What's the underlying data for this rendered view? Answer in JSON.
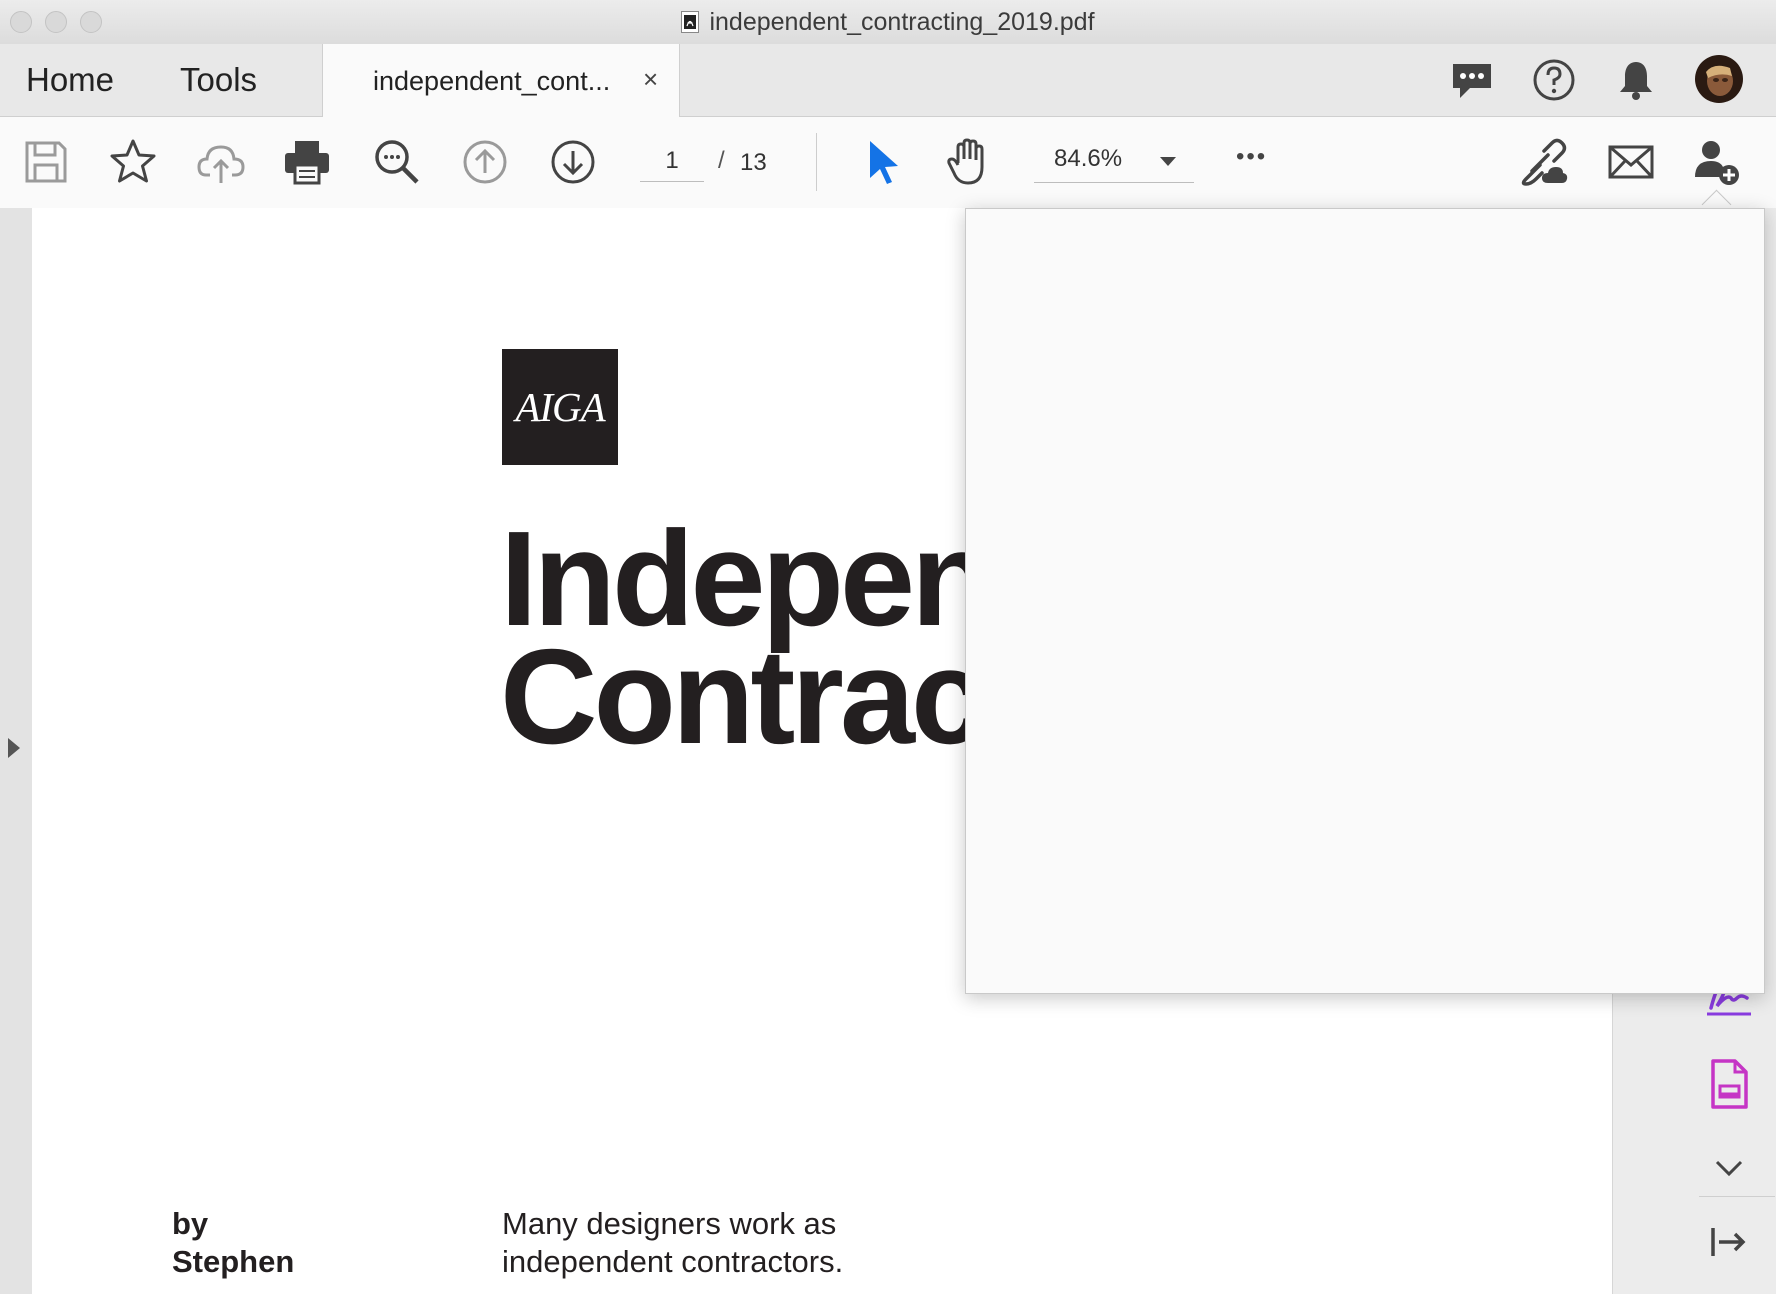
{
  "window": {
    "title": "independent_contracting_2019.pdf"
  },
  "tabs": {
    "home_label": "Home",
    "tools_label": "Tools",
    "document_tab_label": "independent_cont...",
    "close_symbol": "×"
  },
  "toolbar": {
    "page_current": "1",
    "page_separator": "/",
    "page_total": "13",
    "zoom": "84.6%",
    "more_symbol": "•••"
  },
  "document": {
    "logo_text": "AIGA",
    "heading_line1": "Indepen",
    "heading_line2": "Contrac",
    "byline_line1": "by",
    "byline_line2": "Stephen",
    "intro_line1": "Many designers work as",
    "intro_line2": "independent contractors."
  },
  "colors": {
    "select_tool_accent": "#1473e6",
    "fill_sign_accent": "#8a3ce0",
    "forms_accent": "#c535c5"
  },
  "icons": {
    "top_right": [
      "comments-icon",
      "help-icon",
      "notifications-bell-icon",
      "user-avatar"
    ],
    "toolbar": [
      "save-icon",
      "bookmark-star-icon",
      "cloud-upload-icon",
      "print-icon",
      "zoom-search-icon",
      "previous-page-icon",
      "next-page-icon",
      "select-pointer-icon",
      "hand-tool-icon",
      "more-options-icon",
      "share-link-icon",
      "email-icon",
      "add-person-icon"
    ],
    "right_pane": [
      "fill-sign-icon",
      "prepare-form-icon",
      "chevron-down-icon",
      "collapse-pane-icon"
    ]
  }
}
